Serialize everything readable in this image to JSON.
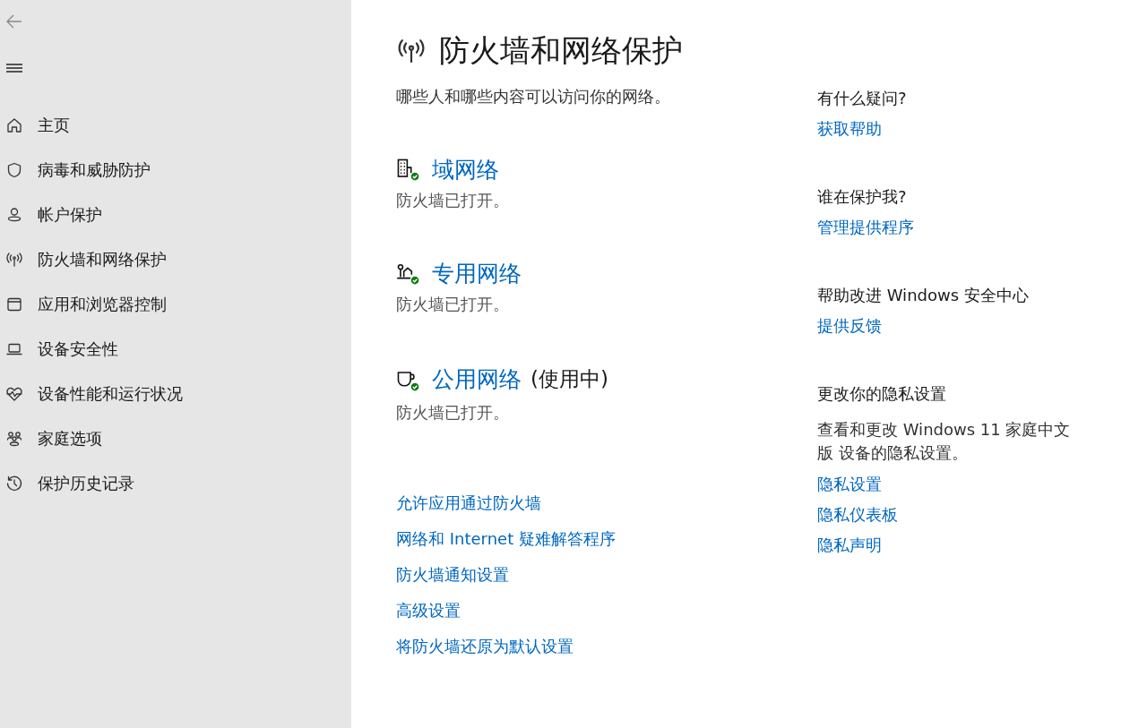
{
  "sidebar": {
    "items": [
      {
        "label": "主页"
      },
      {
        "label": "病毒和威胁防护"
      },
      {
        "label": "帐户保护"
      },
      {
        "label": "防火墙和网络保护"
      },
      {
        "label": "应用和浏览器控制"
      },
      {
        "label": "设备安全性"
      },
      {
        "label": "设备性能和运行状况"
      },
      {
        "label": "家庭选项"
      },
      {
        "label": "保护历史记录"
      }
    ]
  },
  "page": {
    "title": "防火墙和网络保护",
    "subtitle": "哪些人和哪些内容可以访问你的网络。",
    "networks": [
      {
        "name": "域网络",
        "status": "防火墙已打开。",
        "protected": true
      },
      {
        "name": "专用网络",
        "status": "防火墙已打开。",
        "protected": true
      },
      {
        "name": "公用网络",
        "note": "(使用中)",
        "status": "防火墙已打开。",
        "protected": true
      }
    ],
    "links": [
      "允许应用通过防火墙",
      "网络和 Internet 疑难解答程序",
      "防火墙通知设置",
      "高级设置",
      "将防火墙还原为默认设置"
    ]
  },
  "aside": {
    "sections": [
      {
        "heading": "有什么疑问?",
        "links": [
          "获取帮助"
        ]
      },
      {
        "heading": "谁在保护我?",
        "links": [
          "管理提供程序"
        ]
      },
      {
        "heading": "帮助改进 Windows 安全中心",
        "links": [
          "提供反馈"
        ]
      },
      {
        "heading": "更改你的隐私设置",
        "text": "查看和更改 Windows 11 家庭中文版 设备的隐私设置。",
        "links": [
          "隐私设置",
          "隐私仪表板",
          "隐私声明"
        ]
      }
    ]
  }
}
